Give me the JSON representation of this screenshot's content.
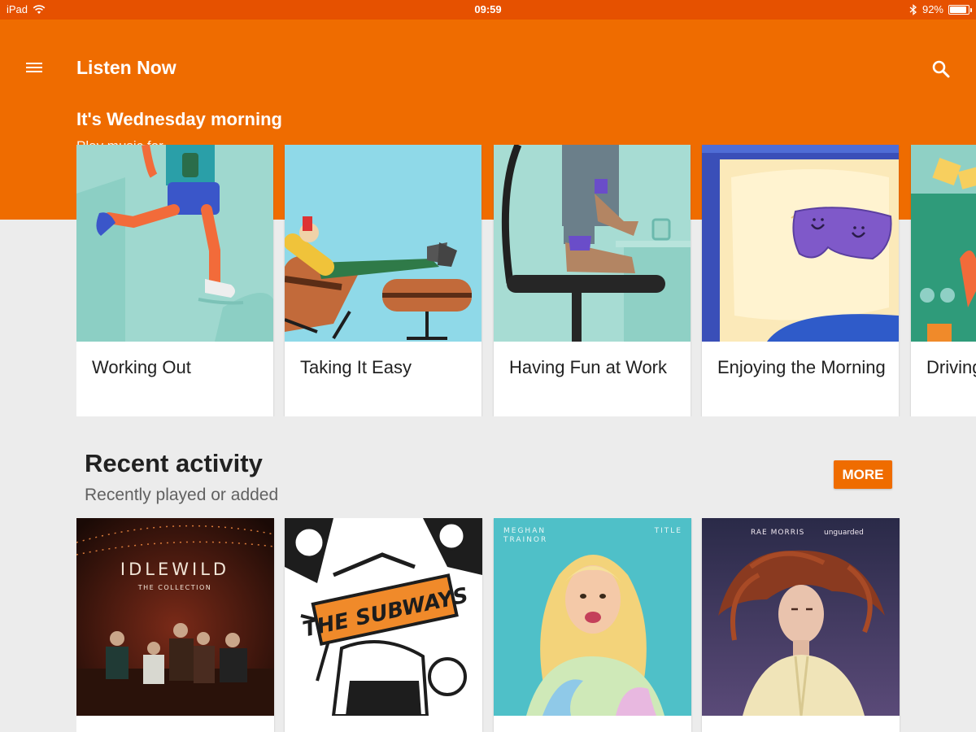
{
  "status_bar": {
    "device": "iPad",
    "time": "09:59",
    "battery": "92%",
    "battery_level": 0.92
  },
  "app_bar": {
    "title": "Listen Now",
    "menu_icon": "hamburger-menu-icon",
    "search_icon": "search-icon"
  },
  "hero": {
    "title": "It's Wednesday morning",
    "subtitle": "Play music for..."
  },
  "activities": [
    {
      "label": "Working Out"
    },
    {
      "label": "Taking It Easy"
    },
    {
      "label": "Having Fun at Work"
    },
    {
      "label": "Enjoying the Morning"
    },
    {
      "label": "Driving"
    }
  ],
  "recent": {
    "title": "Recent activity",
    "subtitle": "Recently played or added",
    "more_label": "MORE",
    "albums": [
      {
        "cover_title": "IDLEWILD",
        "cover_subtitle": "THE COLLECTION"
      },
      {
        "cover_title": "THE SUBWAYS"
      },
      {
        "artist_line1": "MEGHAN",
        "artist_line2": "TRAINOR",
        "cover_title": "TITLE"
      },
      {
        "artist": "RAE MORRIS",
        "cover_title": "unguarded"
      }
    ]
  },
  "colors": {
    "status_bar": "#e65100",
    "accent": "#ef6c00",
    "background": "#ececec"
  }
}
